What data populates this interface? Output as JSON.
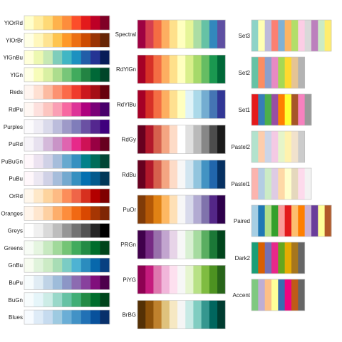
{
  "chart_data": {
    "type": "table",
    "title": "",
    "groups": [
      {
        "kind": "sequential",
        "palettes": [
          {
            "name": "YlOrRd",
            "colors": [
              "#FFFFCC",
              "#FFEDA0",
              "#FED976",
              "#FEB24C",
              "#FD8D3C",
              "#FC4E2A",
              "#E31A1C",
              "#BD0026",
              "#800026"
            ]
          },
          {
            "name": "YlOrBr",
            "colors": [
              "#FFFFE5",
              "#FFF7BC",
              "#FEE391",
              "#FEC44F",
              "#FE9929",
              "#EC7014",
              "#CC4C02",
              "#993404",
              "#662506"
            ]
          },
          {
            "name": "YlGnBu",
            "colors": [
              "#FFFFD9",
              "#EDF8B1",
              "#C7E9B4",
              "#7FCDBB",
              "#41B6C4",
              "#1D91C0",
              "#225EA8",
              "#253494",
              "#081D58"
            ]
          },
          {
            "name": "YlGn",
            "colors": [
              "#FFFFE5",
              "#F7FCB9",
              "#D9F0A3",
              "#ADDD8E",
              "#78C679",
              "#41AB5D",
              "#238443",
              "#006837",
              "#004529"
            ]
          },
          {
            "name": "Reds",
            "colors": [
              "#FFF5F0",
              "#FEE0D2",
              "#FCBBA1",
              "#FC9272",
              "#FB6A4A",
              "#EF3B2C",
              "#CB181D",
              "#A50F15",
              "#67000D"
            ]
          },
          {
            "name": "RdPu",
            "colors": [
              "#FFF7F3",
              "#FDE0DD",
              "#FCC5C0",
              "#FA9FB5",
              "#F768A1",
              "#DD3497",
              "#AE017E",
              "#7A0177",
              "#49006A"
            ]
          },
          {
            "name": "Purples",
            "colors": [
              "#FCFBFD",
              "#EFEDF5",
              "#DADAEB",
              "#BCBDDC",
              "#9E9AC8",
              "#807DBA",
              "#6A51A3",
              "#54278F",
              "#3F007D"
            ]
          },
          {
            "name": "PuRd",
            "colors": [
              "#F7F4F9",
              "#E7E1EF",
              "#D4B9DA",
              "#C994C7",
              "#DF65B0",
              "#E7298A",
              "#CE1256",
              "#980043",
              "#67001F"
            ]
          },
          {
            "name": "PuBuGn",
            "colors": [
              "#FFF7FB",
              "#ECE2F0",
              "#D0D1E6",
              "#A6BDDB",
              "#67A9CF",
              "#3690C0",
              "#02818A",
              "#016C59",
              "#014636"
            ]
          },
          {
            "name": "PuBu",
            "colors": [
              "#FFF7FB",
              "#ECE7F2",
              "#D0D1E6",
              "#A6BDDB",
              "#74A9CF",
              "#3690C0",
              "#0570B0",
              "#045A8D",
              "#023858"
            ]
          },
          {
            "name": "OrRd",
            "colors": [
              "#FFF7EC",
              "#FEE8C8",
              "#FDD49E",
              "#FDBB84",
              "#FC8D59",
              "#EF6548",
              "#D7301F",
              "#B30000",
              "#7F0000"
            ]
          },
          {
            "name": "Oranges",
            "colors": [
              "#FFF5EB",
              "#FEE6CE",
              "#FDD0A2",
              "#FDAE6B",
              "#FD8D3C",
              "#F16913",
              "#D94801",
              "#A63603",
              "#7F2704"
            ]
          },
          {
            "name": "Greys",
            "colors": [
              "#FFFFFF",
              "#F0F0F0",
              "#D9D9D9",
              "#BDBDBD",
              "#969696",
              "#737373",
              "#525252",
              "#252525",
              "#000000"
            ]
          },
          {
            "name": "Greens",
            "colors": [
              "#F7FCF5",
              "#E5F5E0",
              "#C7E9C0",
              "#A1D99B",
              "#74C476",
              "#41AB5D",
              "#238B45",
              "#006D2C",
              "#00441B"
            ]
          },
          {
            "name": "GnBu",
            "colors": [
              "#F7FCF0",
              "#E0F3DB",
              "#CCEBC5",
              "#A8DDB5",
              "#7BCCC4",
              "#4EB3D3",
              "#2B8CBE",
              "#0868AC",
              "#084081"
            ]
          },
          {
            "name": "BuPu",
            "colors": [
              "#F7FCFD",
              "#E0ECF4",
              "#BFD3E6",
              "#9EBCDA",
              "#8C96C6",
              "#8C6BB1",
              "#88419D",
              "#810F7C",
              "#4D004B"
            ]
          },
          {
            "name": "BuGn",
            "colors": [
              "#F7FCFD",
              "#E5F5F9",
              "#CCECE6",
              "#99D8C9",
              "#66C2A4",
              "#41AE76",
              "#238B45",
              "#006D2C",
              "#00441B"
            ]
          },
          {
            "name": "Blues",
            "colors": [
              "#F7FBFF",
              "#DEEBF7",
              "#C6DBEF",
              "#9ECAE1",
              "#6BAED6",
              "#4292C6",
              "#2171B5",
              "#08519C",
              "#08306B"
            ]
          }
        ]
      },
      {
        "kind": "diverging",
        "palettes": [
          {
            "name": "Spectral",
            "colors": [
              "#9E0142",
              "#D53E4F",
              "#F46D43",
              "#FDAE61",
              "#FEE08B",
              "#FFFFBF",
              "#E6F598",
              "#ABDDA4",
              "#66C2A5",
              "#3288BD",
              "#5E4FA2"
            ]
          },
          {
            "name": "RdYlGn",
            "colors": [
              "#A50026",
              "#D73027",
              "#F46D43",
              "#FDAE61",
              "#FEE08B",
              "#FFFFBF",
              "#D9EF8B",
              "#A6D96A",
              "#66BD63",
              "#1A9850",
              "#006837"
            ]
          },
          {
            "name": "RdYlBu",
            "colors": [
              "#A50026",
              "#D73027",
              "#F46D43",
              "#FDAE61",
              "#FEE090",
              "#FFFFBF",
              "#E0F3F8",
              "#ABD9E9",
              "#74ADD1",
              "#4575B4",
              "#313695"
            ]
          },
          {
            "name": "RdGy",
            "colors": [
              "#67001F",
              "#B2182B",
              "#D6604D",
              "#F4A582",
              "#FDDBC7",
              "#FFFFFF",
              "#E0E0E0",
              "#BABABA",
              "#878787",
              "#4D4D4D",
              "#1A1A1A"
            ]
          },
          {
            "name": "RdBu",
            "colors": [
              "#67001F",
              "#B2182B",
              "#D6604D",
              "#F4A582",
              "#FDDBC7",
              "#F7F7F7",
              "#D1E5F0",
              "#92C5DE",
              "#4393C3",
              "#2166AC",
              "#053061"
            ]
          },
          {
            "name": "PuOr",
            "colors": [
              "#7F3B08",
              "#B35806",
              "#E08214",
              "#FDB863",
              "#FEE0B6",
              "#F7F7F7",
              "#D8DAEB",
              "#B2ABD2",
              "#8073AC",
              "#542788",
              "#2D004B"
            ]
          },
          {
            "name": "PRGn",
            "colors": [
              "#40004B",
              "#762A83",
              "#9970AB",
              "#C2A5CF",
              "#E7D4E8",
              "#F7F7F7",
              "#D9F0D3",
              "#A6DBA0",
              "#5AAE61",
              "#1B7837",
              "#00441B"
            ]
          },
          {
            "name": "PiYG",
            "colors": [
              "#8E0152",
              "#C51B7D",
              "#DE77AE",
              "#F1B6DA",
              "#FDE0EF",
              "#F7F7F7",
              "#E6F5D0",
              "#B8E186",
              "#7FBC41",
              "#4D9221",
              "#276419"
            ]
          },
          {
            "name": "BrBG",
            "colors": [
              "#543005",
              "#8C510A",
              "#BF812D",
              "#DFC27D",
              "#F6E8C3",
              "#F5F5F5",
              "#C7EAE5",
              "#80CDC1",
              "#35978F",
              "#01665E",
              "#003C30"
            ]
          }
        ]
      },
      {
        "kind": "qualitative",
        "palettes": [
          {
            "name": "Set3",
            "colors": [
              "#8DD3C7",
              "#FFFFB3",
              "#BEBADA",
              "#FB8072",
              "#80B1D3",
              "#FDB462",
              "#B3DE69",
              "#FCCDE5",
              "#D9D9D9",
              "#BC80BD",
              "#CCEBC5",
              "#FFED6F"
            ]
          },
          {
            "name": "Set2",
            "colors": [
              "#66C2A5",
              "#FC8D62",
              "#8DA0CB",
              "#E78AC3",
              "#A6D854",
              "#FFD92F",
              "#E5C494",
              "#B3B3B3"
            ]
          },
          {
            "name": "Set1",
            "colors": [
              "#E41A1C",
              "#377EB8",
              "#4DAF4A",
              "#984EA3",
              "#FF7F00",
              "#FFFF33",
              "#A65628",
              "#F781BF",
              "#999999"
            ]
          },
          {
            "name": "Pastel2",
            "colors": [
              "#B3E2CD",
              "#FDCDAC",
              "#CBD5E8",
              "#F4CAE4",
              "#E6F5C9",
              "#FFF2AE",
              "#F1E2CC",
              "#CCCCCC"
            ]
          },
          {
            "name": "Pastel1",
            "colors": [
              "#FBB4AE",
              "#B3CDE3",
              "#CCEBC5",
              "#DECBE4",
              "#FED9A6",
              "#FFFFCC",
              "#E5D8BD",
              "#FDDAEC",
              "#F2F2F2"
            ]
          },
          {
            "name": "Paired",
            "colors": [
              "#A6CEE3",
              "#1F78B4",
              "#B2DF8A",
              "#33A02C",
              "#FB9A99",
              "#E31A1C",
              "#FDBF6F",
              "#FF7F00",
              "#CAB2D6",
              "#6A3D9A",
              "#FFFF99",
              "#B15928"
            ]
          },
          {
            "name": "Dark2",
            "colors": [
              "#1B9E77",
              "#D95F02",
              "#7570B3",
              "#E7298A",
              "#66A61E",
              "#E6AB02",
              "#A6761D",
              "#666666"
            ]
          },
          {
            "name": "Accent",
            "colors": [
              "#7FC97F",
              "#BEAED4",
              "#FDC086",
              "#FFFF99",
              "#386CB0",
              "#F0027F",
              "#BF5B17",
              "#666666"
            ]
          }
        ]
      }
    ]
  }
}
